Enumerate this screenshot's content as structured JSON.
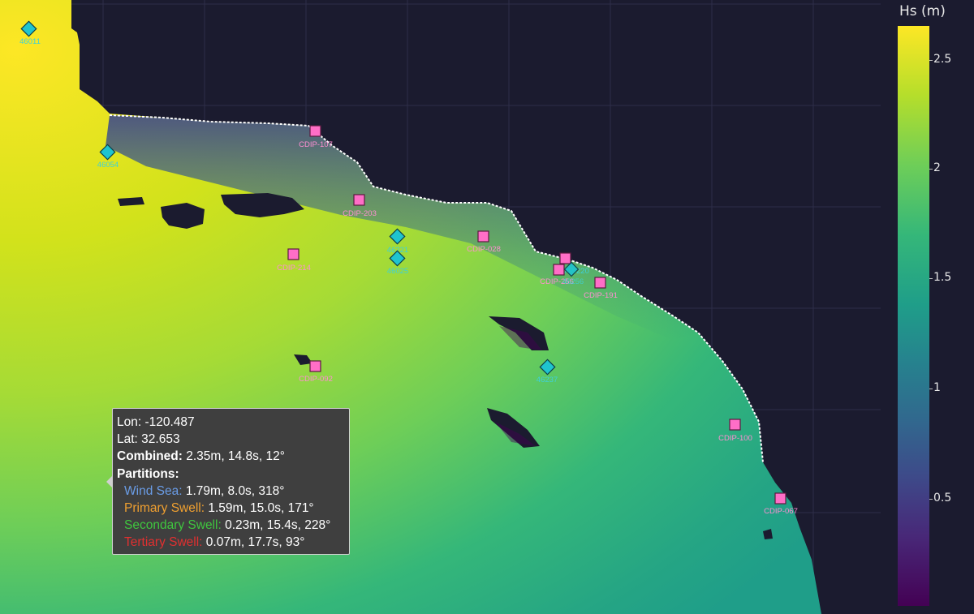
{
  "colorbar": {
    "title": "Hs (m)",
    "ticks": [
      "2.5",
      "2",
      "1.5",
      "1",
      "0.5"
    ],
    "tick_values": [
      2.5,
      2,
      1.5,
      1,
      0.5
    ],
    "range": [
      0,
      2.65
    ],
    "colors": [
      "#440154",
      "#482878",
      "#3e4989",
      "#31688e",
      "#26828e",
      "#1f9e89",
      "#35b779",
      "#6ece58",
      "#b5de2b",
      "#fde725"
    ]
  },
  "colors": {
    "land": "#1b1b2f",
    "buoy_ndbc": "#1fc4cf",
    "buoy_cdip": "#ff6ec7",
    "buoy_ndbc_label": "#3fd0d8",
    "buoy_cdip_label": "#ff8fd3"
  },
  "buoys": [
    {
      "id": "46011",
      "type": "ndbc"
    },
    {
      "id": "46054",
      "type": "ndbc"
    },
    {
      "id": "CDIP-107",
      "type": "cdip"
    },
    {
      "id": "CDIP-203",
      "type": "cdip"
    },
    {
      "id": "CDIP-214",
      "type": "cdip"
    },
    {
      "id": "46221",
      "type": "ndbc"
    },
    {
      "id": "46025",
      "type": "ndbc"
    },
    {
      "id": "CDIP-028",
      "type": "cdip"
    },
    {
      "id": "CDIP-220",
      "type": "cdip"
    },
    {
      "id": "CDIP-256",
      "type": "cdip"
    },
    {
      "id": "46256",
      "type": "ndbc"
    },
    {
      "id": "CDIP-191",
      "type": "cdip"
    },
    {
      "id": "CDIP-092",
      "type": "cdip"
    },
    {
      "id": "46237",
      "type": "ndbc"
    },
    {
      "id": "CDIP-100",
      "type": "cdip"
    },
    {
      "id": "CDIP-067",
      "type": "cdip"
    }
  ],
  "tooltip": {
    "lon": "Lon: -120.487",
    "lat": "Lat: 32.653",
    "combined_label": "Combined:",
    "combined_value": " 2.35m, 14.8s, 12°",
    "partitions_label": "Partitions:",
    "wind_sea_label": "Wind Sea:",
    "wind_sea_value": " 1.79m, 8.0s, 318°",
    "primary_label": "Primary Swell:",
    "primary_value": " 1.59m, 15.0s, 171°",
    "secondary_label": "Secondary Swell:",
    "secondary_value": " 0.23m, 15.4s, 228°",
    "tertiary_label": "Tertiary Swell:",
    "tertiary_value": " 0.07m, 17.7s, 93°",
    "wind_sea_color": "#6a9ce6",
    "primary_color": "#f0a030",
    "secondary_color": "#3fc63f",
    "tertiary_color": "#e03030"
  }
}
